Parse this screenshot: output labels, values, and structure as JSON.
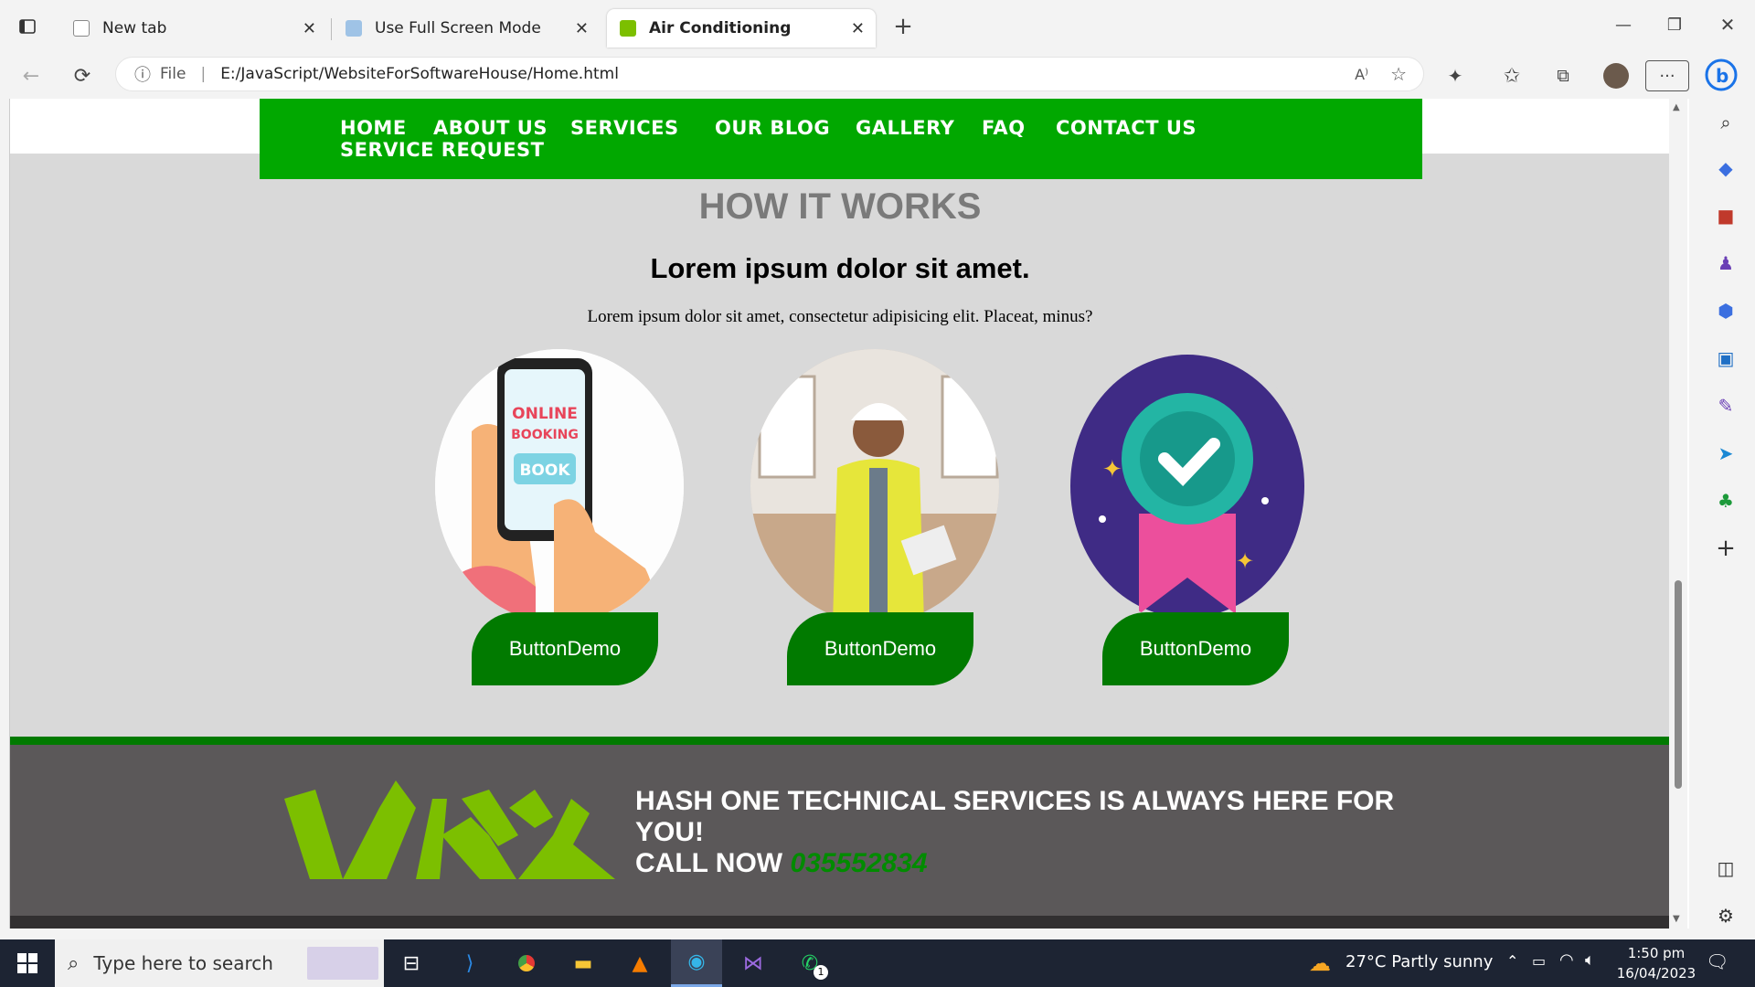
{
  "browser": {
    "tabs": [
      {
        "label": "New tab"
      },
      {
        "label": "Use Full Screen Mode"
      },
      {
        "label": "Air Conditioning"
      }
    ],
    "address": {
      "scheme": "File",
      "url": "E:/JavaScript/WebsiteForSoftwareHouse/Home.html"
    }
  },
  "site": {
    "nav": [
      "HOME",
      "ABOUT US",
      "SERVICES",
      "OUR BLOG",
      "GALLERY",
      "FAQ",
      "CONTACT US",
      "SERVICE REQUEST"
    ],
    "heading": "HOW IT WORKS",
    "subheading": "Lorem ipsum dolor sit amet.",
    "paragraph": "Lorem ipsum dolor sit amet, consectetur adipisicing elit. Placeat, minus?",
    "cards": [
      {
        "image_text_1": "ONLINE",
        "image_text_2": "BOOKING",
        "image_text_3": "BOOK",
        "button": "ButtonDemo"
      },
      {
        "button": "ButtonDemo"
      },
      {
        "button": "ButtonDemo"
      }
    ],
    "footer": {
      "line1": "HASH ONE TECHNICAL SERVICES IS ALWAYS HERE FOR YOU!",
      "call": "CALL NOW",
      "phone": "035552834"
    }
  },
  "taskbar": {
    "search_placeholder": "Type here to search",
    "weather": "27°C  Partly sunny",
    "time": "1:50 pm",
    "date": "16/04/2023",
    "whatsapp_badge": "1"
  },
  "colors": {
    "nav_green": "#01a800",
    "button_green": "#017a00",
    "footer_gray": "#5b5859",
    "logo_green": "#7cbf00"
  }
}
